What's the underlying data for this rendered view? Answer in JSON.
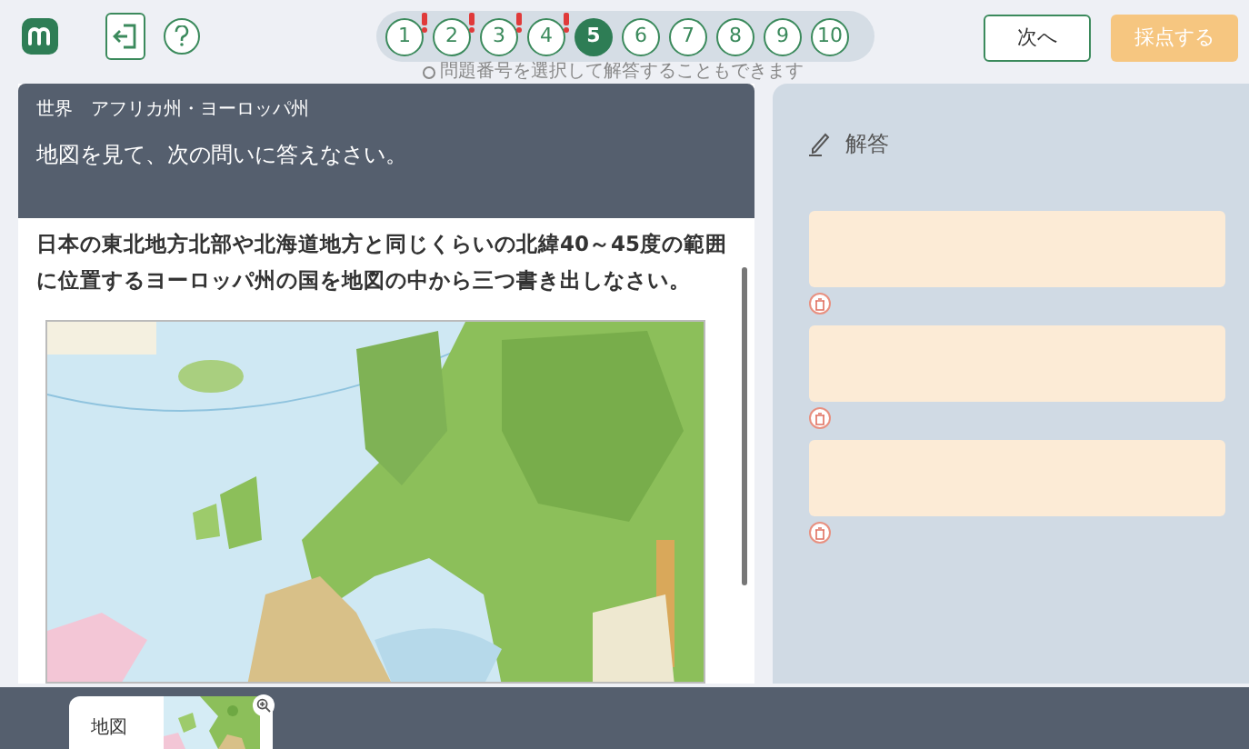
{
  "toolbar": {
    "next_button": "次へ",
    "grade_button": "採点する"
  },
  "questions": [
    {
      "label": "1",
      "alert": true,
      "selected": false
    },
    {
      "label": "2",
      "alert": true,
      "selected": false
    },
    {
      "label": "3",
      "alert": true,
      "selected": false
    },
    {
      "label": "4",
      "alert": true,
      "selected": false
    },
    {
      "label": "5",
      "alert": false,
      "selected": true
    },
    {
      "label": "6",
      "alert": false,
      "selected": false
    },
    {
      "label": "7",
      "alert": false,
      "selected": false
    },
    {
      "label": "8",
      "alert": false,
      "selected": false
    },
    {
      "label": "9",
      "alert": false,
      "selected": false
    },
    {
      "label": "10",
      "alert": false,
      "selected": false
    }
  ],
  "pager_hint": "問題番号を選択して解答することもできます",
  "question": {
    "unit": "世界　アフリカ州・ヨーロッパ州",
    "instruction": "地図を見て、次の問いに答えなさい。",
    "prompt": "日本の東北地方北部や北海道地方と同じくらいの北緯40～45度の範囲に位置するヨーロッパ州の国を地図の中から三つ書き出しなさい。"
  },
  "answer_panel": {
    "title": "解答",
    "fields": [
      {
        "kind": "text"
      },
      {
        "kind": "text"
      },
      {
        "kind": "text"
      }
    ]
  },
  "bottom_tabs": [
    {
      "label": "地図",
      "selected": true
    }
  ]
}
